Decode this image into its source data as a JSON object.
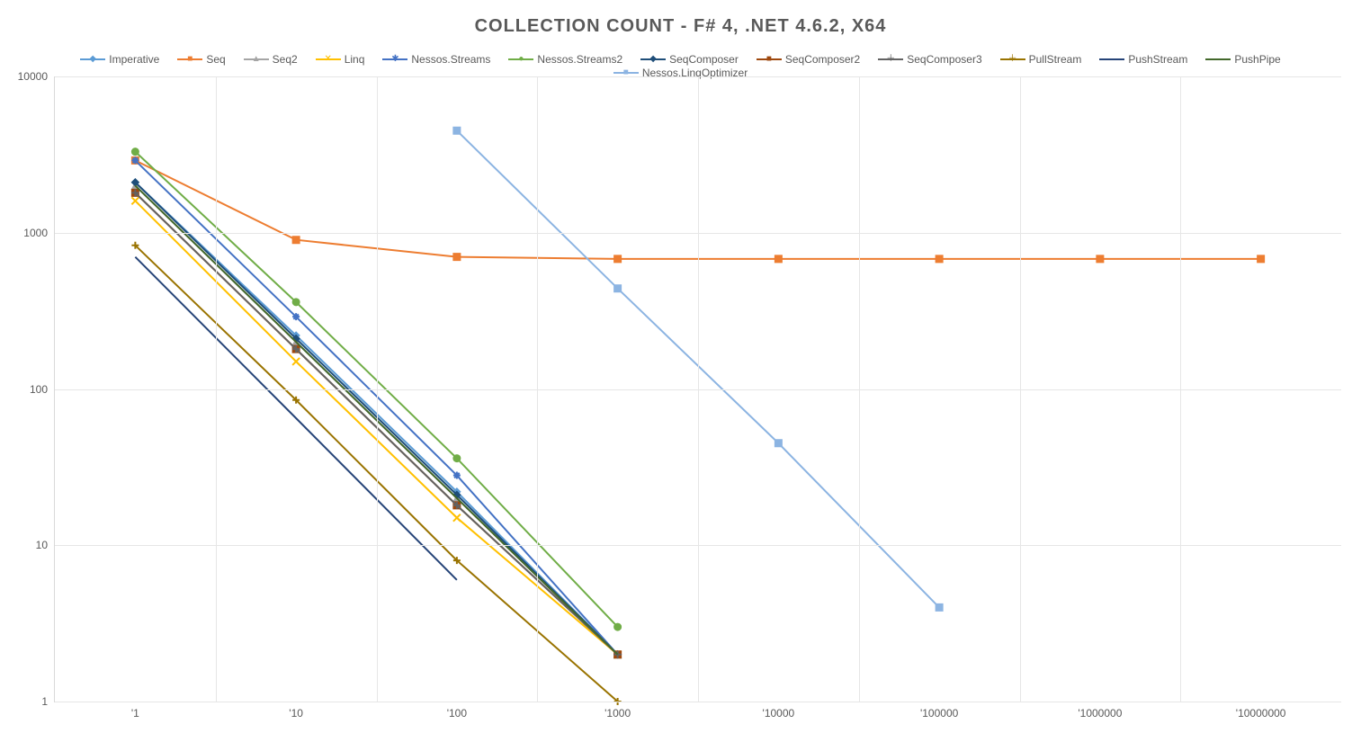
{
  "chart_data": {
    "type": "line",
    "title": "COLLECTION COUNT - F# 4, .NET 4.6.2, X64",
    "xlabel": "",
    "ylabel": "",
    "x_scale": "log",
    "y_scale": "log",
    "ylim": [
      1,
      10000
    ],
    "y_ticks": [
      1,
      10,
      100,
      1000,
      10000
    ],
    "y_tick_labels": [
      "1",
      "10",
      "100",
      "1000",
      "10000"
    ],
    "categories": [
      "'1",
      "'10",
      "'100",
      "'1000",
      "'10000",
      "'100000",
      "'1000000",
      "'10000000"
    ],
    "plot_extent": {
      "half_slot_pad": true
    },
    "series": [
      {
        "name": "Imperative",
        "color": "#5b9bd5",
        "marker": "diamond",
        "values": [
          2100,
          220,
          22,
          2,
          null,
          null,
          null,
          null
        ]
      },
      {
        "name": "Seq",
        "color": "#ed7d31",
        "marker": "square",
        "values": [
          2900,
          900,
          700,
          680,
          680,
          680,
          680,
          680
        ]
      },
      {
        "name": "Seq2",
        "color": "#a5a5a5",
        "marker": "triangle",
        "values": [
          2000,
          200,
          20,
          2,
          null,
          null,
          null,
          null
        ]
      },
      {
        "name": "Linq",
        "color": "#ffc000",
        "marker": "x",
        "values": [
          1600,
          150,
          15,
          2,
          null,
          null,
          null,
          null
        ]
      },
      {
        "name": "Nessos.Streams",
        "color": "#4472c4",
        "marker": "star",
        "values": [
          2900,
          290,
          28,
          2,
          null,
          null,
          null,
          null
        ]
      },
      {
        "name": "Nessos.Streams2",
        "color": "#70ad47",
        "marker": "circle",
        "values": [
          3300,
          360,
          36,
          3,
          null,
          null,
          null,
          null
        ]
      },
      {
        "name": "SeqComposer",
        "color": "#1f4e79",
        "marker": "diamond",
        "values": [
          2100,
          210,
          21,
          2,
          null,
          null,
          null,
          null
        ]
      },
      {
        "name": "SeqComposer2",
        "color": "#9e480e",
        "marker": "square",
        "values": [
          1800,
          180,
          18,
          2,
          null,
          null,
          null,
          null
        ]
      },
      {
        "name": "SeqComposer3",
        "color": "#636363",
        "marker": "plus",
        "values": [
          1800,
          180,
          18,
          2,
          null,
          null,
          null,
          null
        ]
      },
      {
        "name": "PullStream",
        "color": "#997300",
        "marker": "plus",
        "values": [
          830,
          85,
          8,
          1,
          null,
          null,
          null,
          null
        ]
      },
      {
        "name": "PushStream",
        "color": "#264478",
        "marker": "none",
        "values": [
          700,
          65,
          6,
          null,
          null,
          null,
          null,
          null
        ]
      },
      {
        "name": "PushPipe",
        "color": "#43682b",
        "marker": "none",
        "values": [
          2000,
          200,
          20,
          2,
          null,
          null,
          null,
          null
        ]
      },
      {
        "name": "Nessos.LinqOptimizer",
        "color": "#8cb4e2",
        "marker": "square",
        "values": [
          null,
          null,
          4500,
          440,
          45,
          4,
          null,
          null
        ]
      }
    ]
  }
}
